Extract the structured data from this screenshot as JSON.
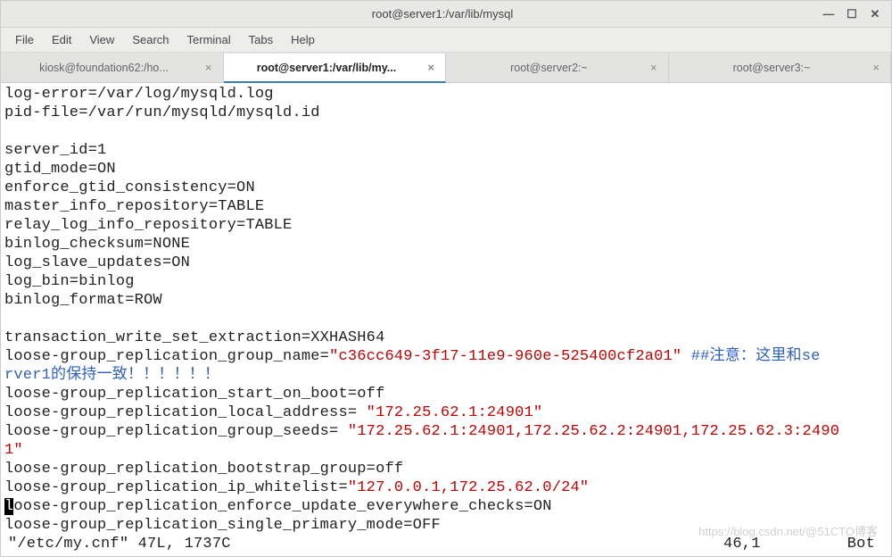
{
  "window": {
    "title": "root@server1:/var/lib/mysql"
  },
  "menu": {
    "file": "File",
    "edit": "Edit",
    "view": "View",
    "search": "Search",
    "terminal": "Terminal",
    "tabs": "Tabs",
    "help": "Help"
  },
  "tabs": [
    {
      "label": "kiosk@foundation62:/ho...",
      "active": false
    },
    {
      "label": "root@server1:/var/lib/my...",
      "active": true
    },
    {
      "label": "root@server2:~",
      "active": false
    },
    {
      "label": "root@server3:~",
      "active": false
    }
  ],
  "file": {
    "log_error": "log-error=/var/log/mysqld.log",
    "pid_file": "pid-file=/var/run/mysqld/mysqld.id",
    "blank1": "",
    "server_id": "server_id=1",
    "gtid_mode": "gtid_mode=ON",
    "enforce_gtid": "enforce_gtid_consistency=ON",
    "master_info": "master_info_repository=TABLE",
    "relay_log": "relay_log_info_repository=TABLE",
    "binlog_checksum": "binlog_checksum=NONE",
    "log_slave": "log_slave_updates=ON",
    "log_bin": "log_bin=binlog",
    "binlog_format": "binlog_format=ROW",
    "blank2": "",
    "txset": "transaction_write_set_extraction=XXHASH64",
    "group_name_prefix": "loose-group_replication_group_name=",
    "group_name_value": "\"c36cc649-3f17-11e9-960e-525400cf2a01\"",
    "comment1a": " ##注意：这里和se",
    "comment1b": "rver1的保持一致！！！！！！",
    "start_on_boot": "loose-group_replication_start_on_boot=off",
    "local_addr_prefix": "loose-group_replication_local_address= ",
    "local_addr_value": "\"172.25.62.1:24901\"",
    "group_seeds_prefix": "loose-group_replication_group_seeds= ",
    "group_seeds_value_a": "\"172.25.62.1:24901,172.25.62.2:24901,172.25.62.3:2490",
    "group_seeds_value_b": "1\"",
    "bootstrap": "loose-group_replication_bootstrap_group=off",
    "ip_whitelist_prefix": "loose-group_replication_ip_whitelist=",
    "ip_whitelist_value": "\"127.0.0.1,172.25.62.0/24\"",
    "enforce_prefix_first": "l",
    "enforce_rest": "oose-group_replication_enforce_update_everywhere_checks=ON",
    "single_primary": "loose-group_replication_single_primary_mode=OFF"
  },
  "status": {
    "left": "\"/etc/my.cnf\" 47L, 1737C",
    "colrow": "46,1",
    "pos": "Bot"
  },
  "watermark": "https://blog.csdn.net/@51CTO博客"
}
